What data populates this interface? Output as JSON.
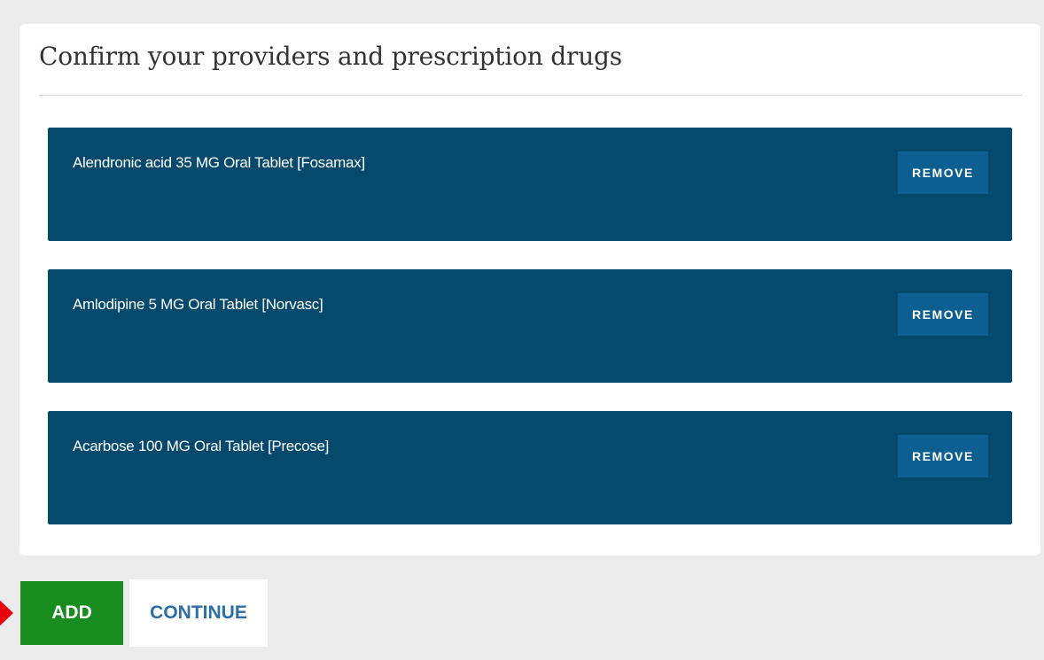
{
  "card": {
    "title": "Confirm your providers and prescription drugs"
  },
  "drugs": [
    {
      "name": "Alendronic acid 35 MG Oral Tablet [Fosamax]",
      "remove_label": "REMOVE"
    },
    {
      "name": "Amlodipine 5 MG Oral Tablet [Norvasc]",
      "remove_label": "REMOVE"
    },
    {
      "name": "Acarbose 100 MG Oral Tablet [Precose]",
      "remove_label": "REMOVE"
    }
  ],
  "actions": {
    "add_label": "ADD",
    "continue_label": "CONTINUE"
  },
  "colors": {
    "background": "#ececec",
    "drug_item": "#054a6d",
    "remove_button": "#0d5f92",
    "add_button": "#198c1f",
    "continue_text": "#2a6fa8",
    "pointer_arrow": "#e8000b"
  }
}
